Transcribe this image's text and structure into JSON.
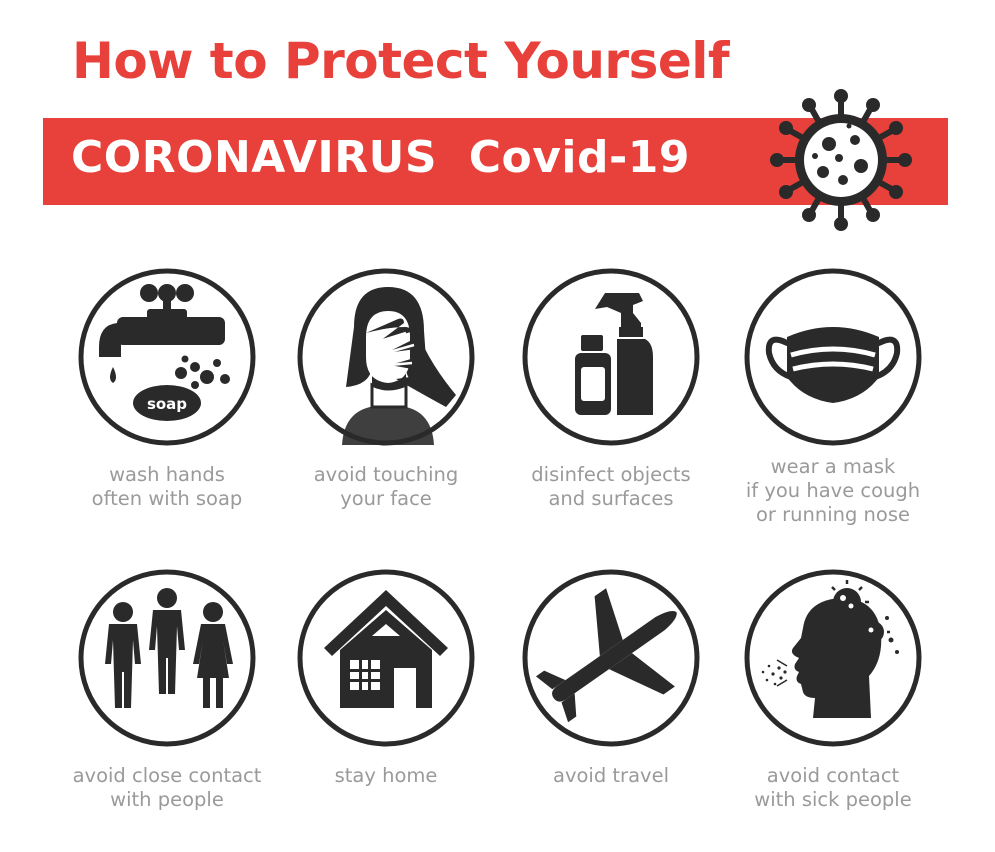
{
  "title": "How to Protect Yourself",
  "banner": {
    "text": "CORONAVIRUS  Covid-19"
  },
  "colors": {
    "accent": "#e8403a",
    "icon": "#2a2a2a",
    "caption": "#9a9a9a"
  },
  "tips": [
    {
      "icon": "faucet-soap-icon",
      "lines": [
        "wash hands",
        "often with soap"
      ],
      "soap_label": "soap"
    },
    {
      "icon": "face-touch-icon",
      "lines": [
        "avoid touching",
        "your face"
      ]
    },
    {
      "icon": "spray-bottle-icon",
      "lines": [
        "disinfect objects",
        "and surfaces"
      ]
    },
    {
      "icon": "face-mask-icon",
      "lines": [
        "wear a mask",
        "if you have cough",
        "or running nose"
      ]
    },
    {
      "icon": "people-icon",
      "lines": [
        "avoid close contact",
        "with people"
      ]
    },
    {
      "icon": "house-icon",
      "lines": [
        "stay home"
      ]
    },
    {
      "icon": "airplane-icon",
      "lines": [
        "avoid travel"
      ]
    },
    {
      "icon": "sick-person-icon",
      "lines": [
        "avoid contact",
        "with sick people"
      ]
    }
  ]
}
